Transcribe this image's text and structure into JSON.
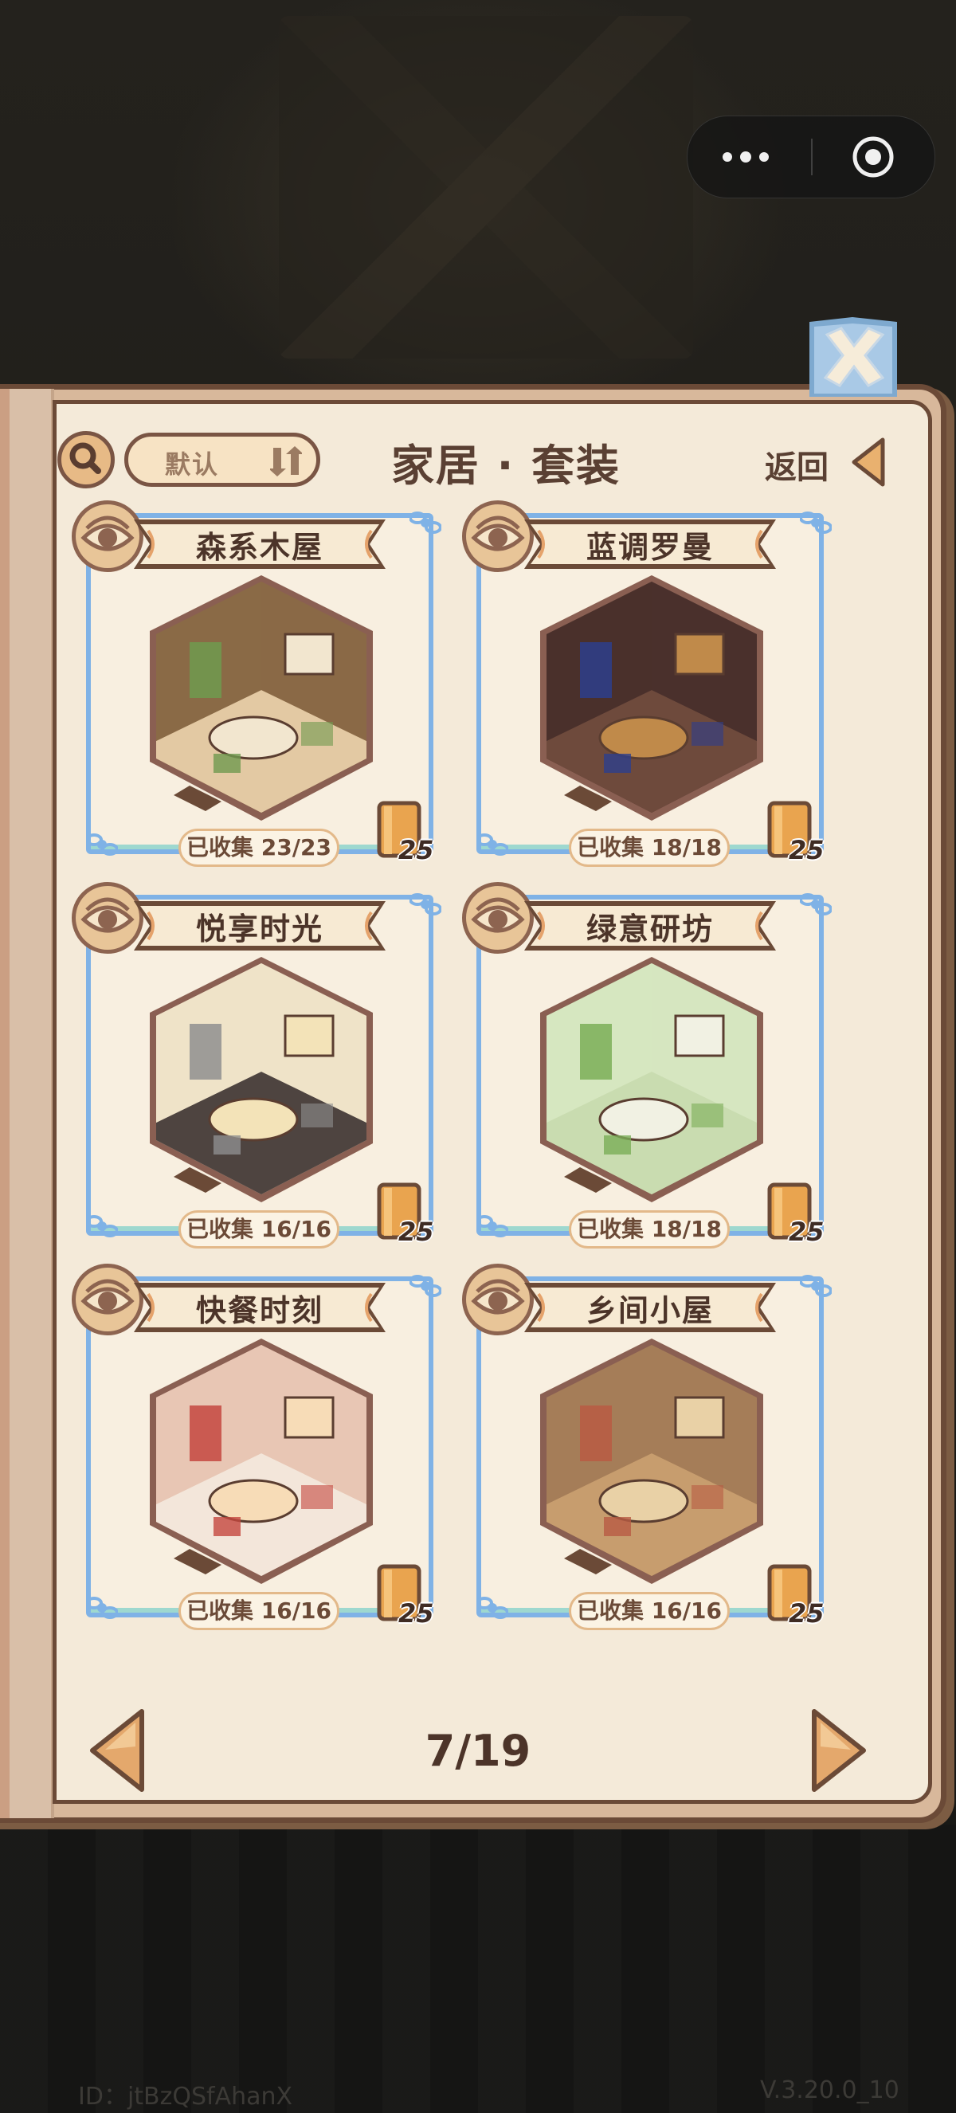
{
  "header": {
    "title": "家居 · 套装",
    "sort_label": "默认",
    "back_label": "返回"
  },
  "cards": [
    {
      "name": "森系木屋",
      "collected": "已收集 23/23",
      "book_count": "25",
      "theme": "forest"
    },
    {
      "name": "蓝调罗曼",
      "collected": "已收集 18/18",
      "book_count": "25",
      "theme": "blues"
    },
    {
      "name": "悦享时光",
      "collected": "已收集 16/16",
      "book_count": "25",
      "theme": "leisure"
    },
    {
      "name": "绿意研坊",
      "collected": "已收集 18/18",
      "book_count": "25",
      "theme": "green"
    },
    {
      "name": "快餐时刻",
      "collected": "已收集 16/16",
      "book_count": "25",
      "theme": "diner"
    },
    {
      "name": "乡间小屋",
      "collected": "已收集 16/16",
      "book_count": "25",
      "theme": "cottage"
    }
  ],
  "pagination": {
    "current": 7,
    "total": 19,
    "label": "7/19"
  },
  "footer": {
    "id": "ID：jtBzQSfAhanX",
    "version": "V.3.20.0_10"
  },
  "colors": {
    "frame": "#7fb2e6",
    "page": "#f4ead9",
    "border": "#6b4a37",
    "accent": "#e7ba86"
  }
}
